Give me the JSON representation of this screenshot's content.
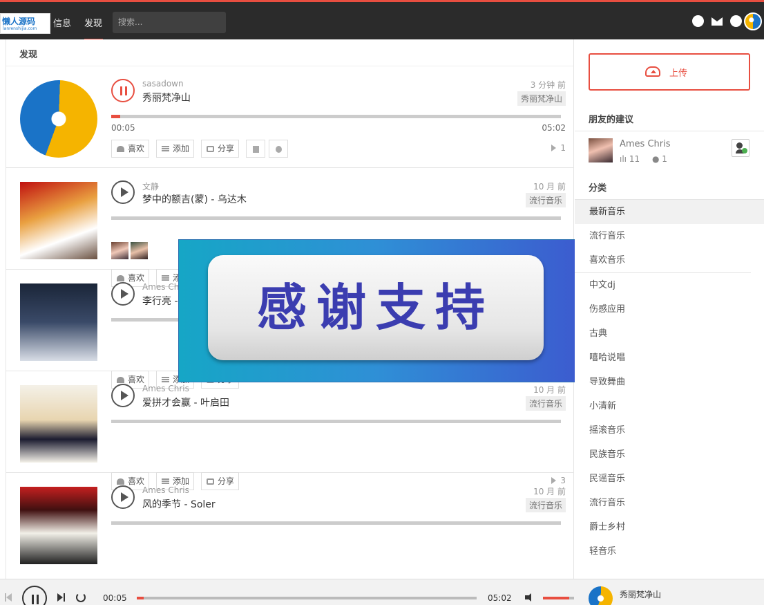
{
  "nav": {
    "logo_text": "懒人源码",
    "logo_sub": "lanrenshijia.com",
    "items": [
      {
        "label": "信息"
      },
      {
        "label": "发现"
      }
    ],
    "search_placeholder": "搜索..."
  },
  "feed": {
    "title": "发现",
    "items": [
      {
        "user": "sasadown",
        "song": "秀丽梵净山",
        "time": "3 分钟 前",
        "tag": "秀丽梵净山",
        "state": "playing",
        "progress": 0.02,
        "elapsed": "00:05",
        "duration": "05:02",
        "plays": "1",
        "actions": {
          "like": "喜欢",
          "add": "添加",
          "share": "分享"
        }
      },
      {
        "user": "文静",
        "song": "梦中的额吉(蒙) - 乌达木",
        "time": "10 月 前",
        "tag": "流行音乐",
        "state": "paused",
        "actions": {
          "like": "喜欢",
          "add": "添加"
        }
      },
      {
        "user": "Ames Chris",
        "song": "李行亮 - ",
        "time": "",
        "tag": "",
        "state": "paused",
        "actions": {
          "like": "喜欢",
          "add": "添加",
          "share": "分享"
        }
      },
      {
        "user": "Ames Chris",
        "song": "爱拼才会赢 - 叶启田",
        "time": "10 月 前",
        "tag": "流行音乐",
        "state": "paused",
        "plays": "3",
        "actions": {
          "like": "喜欢",
          "add": "添加",
          "share": "分享"
        }
      },
      {
        "user": "Ames Chris",
        "song": "风的季节 - Soler",
        "time": "10 月 前",
        "tag": "流行音乐",
        "state": "paused"
      }
    ]
  },
  "overlay": {
    "text": "感谢支持"
  },
  "sidebar": {
    "upload_label": "上传",
    "friends_title": "朋友的建议",
    "friend": {
      "name": "Ames Chris",
      "tracks": "11",
      "followers": "1"
    },
    "categories_title": "分类",
    "categories": [
      "最新音乐",
      "流行音乐",
      "喜欢音乐",
      "中文dj",
      "伤感应用",
      "古典",
      "嘻哈说唱",
      "导致舞曲",
      "小清新",
      "摇滚音乐",
      "民族音乐",
      "民谣音乐",
      "流行音乐",
      "爵士乡村",
      "轻音乐"
    ]
  },
  "player": {
    "elapsed": "00:05",
    "duration": "05:02",
    "progress": 0.02,
    "volume": 0.85,
    "now_playing": "秀丽梵净山"
  },
  "colors": {
    "accent": "#e84e40",
    "topbar": "#2b2b2b"
  }
}
